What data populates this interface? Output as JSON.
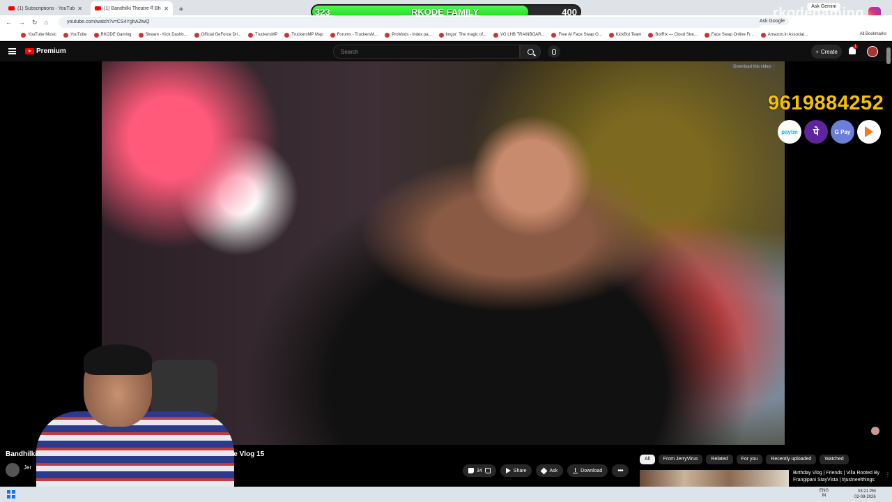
{
  "browser": {
    "tabs": [
      {
        "title": "(1) Subscriptions - YouTube",
        "active": false
      },
      {
        "title": "(1) Bandhilki Theatre में Bho...",
        "active": true
      }
    ],
    "url": "youtube.com/watch?v=CS4YghA2lwQ",
    "ask_google": "Ask Google",
    "ask_gemini": "Ask Gemini",
    "bookmarks": [
      "YouTube Music",
      "YouTube",
      "RKODE Gaming",
      "Stream - Kick Dashb...",
      "Official GeForce Dri...",
      "TruckersMP",
      "TruckersMP Map",
      "Forums - TruckersM...",
      "ProMods - Index pa...",
      "Imgur: The magic of...",
      "VG LHB TRAINBOAR...",
      "Free AI Face Swap O...",
      "KickBot Team",
      "BotRix — Cloud Stre...",
      "Face Swap Online Fr...",
      "Amazon.in Associat..."
    ],
    "all_bookmarks": "All Bookmarks"
  },
  "overlay": {
    "current": "323",
    "label": "RKODE FAMILY",
    "goal": "400",
    "progress_fraction": 0.8075,
    "fill_color": "#22e022",
    "brand": "rkodegaming"
  },
  "youtube": {
    "logo_text": "Premium",
    "search_placeholder": "Search",
    "create_label": "Create",
    "notif_count": "1",
    "video_download": "Download this video",
    "title_start": "Bandhilki",
    "title_end": "Simple Vlog 15",
    "channel_name": "Jer",
    "actions": {
      "likes": "34",
      "share": "Share",
      "ask": "Ask",
      "download": "Download"
    },
    "chips": [
      "All",
      "From JerryVirus",
      "Related",
      "For you",
      "Recently uploaded",
      "Watched"
    ],
    "recommendation": {
      "title": "Birthday Vlog | Friends | Villa Rooted By Frangipani StayVista | #justneelthings"
    }
  },
  "donation": {
    "phone": "9619884252",
    "apps": [
      "paytm",
      "पे",
      "G Pay",
      "BHIM"
    ]
  },
  "taskbar": {
    "lang_top": "ENG",
    "lang_bottom": "IN",
    "time": "03:21 PM",
    "date": "02-08-2026"
  }
}
